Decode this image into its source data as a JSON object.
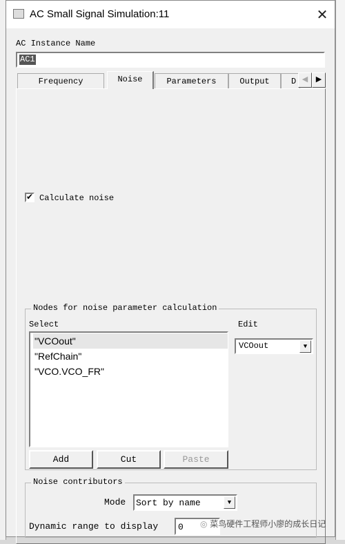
{
  "window": {
    "title": "AC Small Signal Simulation:11",
    "close_icon": "close-icon"
  },
  "instance": {
    "label": "AC Instance Name",
    "value": "AC1"
  },
  "tabs": [
    {
      "label": "Frequency"
    },
    {
      "label": "Noise",
      "selected": true
    },
    {
      "label": "Parameters"
    },
    {
      "label": "Output"
    },
    {
      "label": "D"
    }
  ],
  "noise": {
    "calculate_label": "Calculate noise",
    "calculate_checked": true,
    "nodes_group": {
      "title": "Nodes for noise parameter calculation",
      "select_label": "Select",
      "edit_label": "Edit",
      "items": [
        "\"VCOout\"",
        "\"RefChain\"",
        "\"VCO.VCO_FR\""
      ],
      "selected_index": 0,
      "edit_value": "VCOout",
      "add": "Add",
      "cut": "Cut",
      "paste": "Paste"
    },
    "contributors": {
      "title": "Noise contributors",
      "mode_label": "Mode",
      "mode_value": "Sort by name",
      "range_label": "Dynamic range to display",
      "range_value": "0"
    }
  },
  "watermark": "菜鸟硬件工程师小廖的成长日记"
}
